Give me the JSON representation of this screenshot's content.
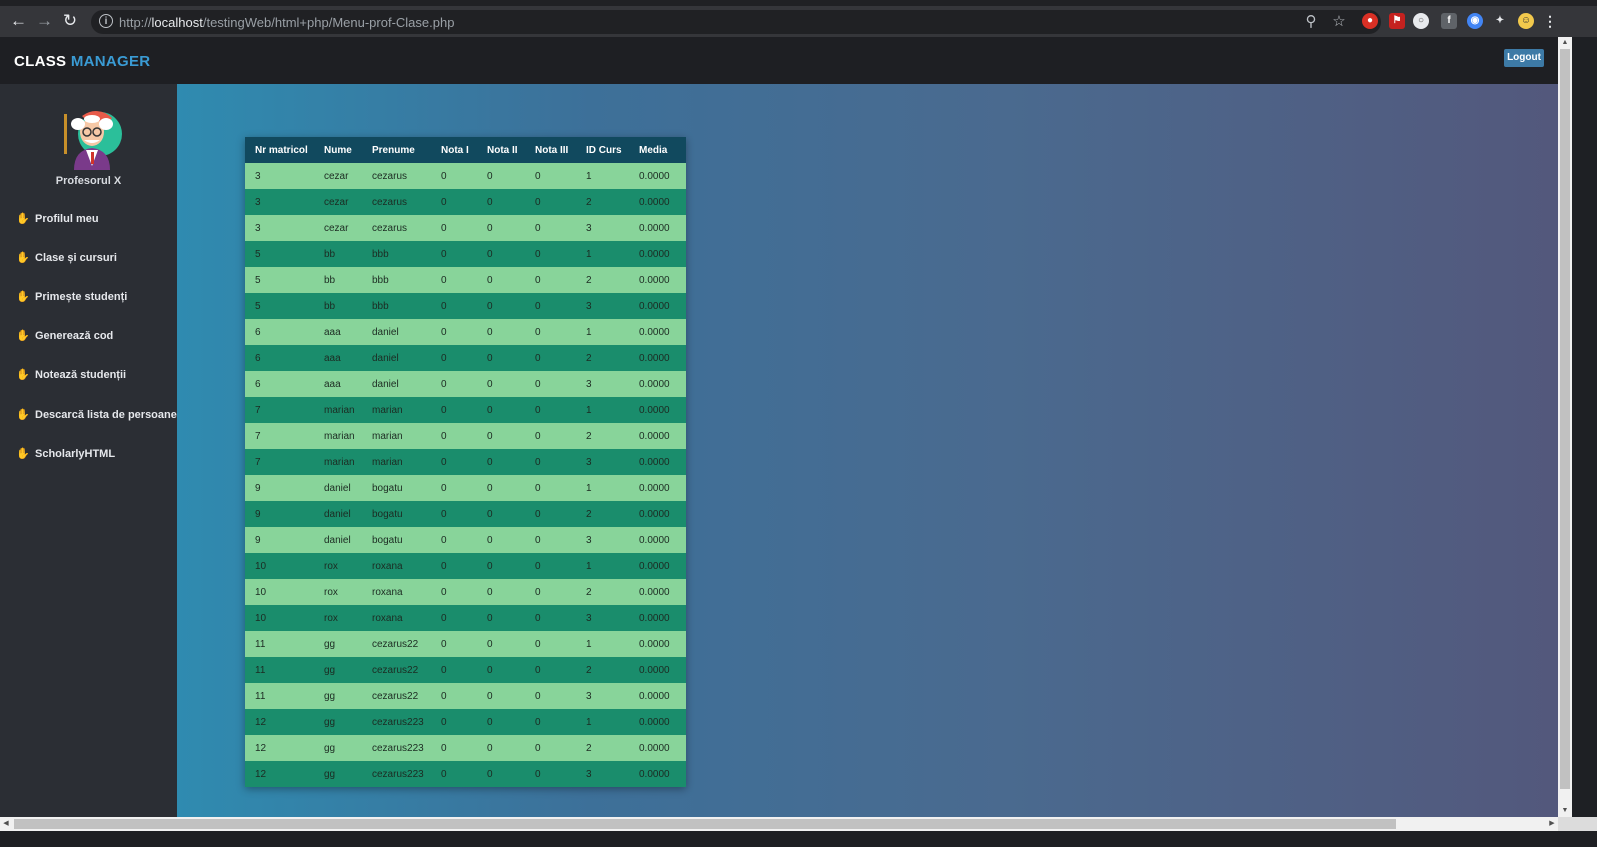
{
  "browser": {
    "url_host": "localhost",
    "url_prefix": "http://",
    "url_path": "/testingWeb/html+php/Menu-prof-Clase.php",
    "icons": [
      "back-icon",
      "forward-icon",
      "reload-icon",
      "info-icon",
      "zoom-icon",
      "star-icon",
      "extensions-icon",
      "menu-icon"
    ]
  },
  "header": {
    "brand_part1": "CLASS",
    "brand_part2": "MANAGER",
    "logout_label": "Logout"
  },
  "colors": {
    "brand_accent": "#3a9bd4",
    "table_header": "#11495e",
    "row_light": "#88d49a",
    "row_dark": "#1a8d6c",
    "sidebar_bg": "#2b2e34"
  },
  "sidebar": {
    "profile_name": "Profesorul X",
    "items": [
      {
        "label": "Profilul meu"
      },
      {
        "label": "Clase și cursuri"
      },
      {
        "label": "Primește studenți"
      },
      {
        "label": "Generează cod"
      },
      {
        "label": "Notează studenții"
      },
      {
        "label": "Descarcă lista de persoane"
      },
      {
        "label": "ScholarlyHTML"
      }
    ]
  },
  "table": {
    "columns": [
      "Nr matricol",
      "Nume",
      "Prenume",
      "Nota I",
      "Nota II",
      "Nota III",
      "ID Curs",
      "Media"
    ],
    "rows": [
      [
        "3",
        "cezar",
        "cezarus",
        "0",
        "0",
        "0",
        "1",
        "0.0000"
      ],
      [
        "3",
        "cezar",
        "cezarus",
        "0",
        "0",
        "0",
        "2",
        "0.0000"
      ],
      [
        "3",
        "cezar",
        "cezarus",
        "0",
        "0",
        "0",
        "3",
        "0.0000"
      ],
      [
        "5",
        "bb",
        "bbb",
        "0",
        "0",
        "0",
        "1",
        "0.0000"
      ],
      [
        "5",
        "bb",
        "bbb",
        "0",
        "0",
        "0",
        "2",
        "0.0000"
      ],
      [
        "5",
        "bb",
        "bbb",
        "0",
        "0",
        "0",
        "3",
        "0.0000"
      ],
      [
        "6",
        "aaa",
        "daniel",
        "0",
        "0",
        "0",
        "1",
        "0.0000"
      ],
      [
        "6",
        "aaa",
        "daniel",
        "0",
        "0",
        "0",
        "2",
        "0.0000"
      ],
      [
        "6",
        "aaa",
        "daniel",
        "0",
        "0",
        "0",
        "3",
        "0.0000"
      ],
      [
        "7",
        "marian",
        "marian",
        "0",
        "0",
        "0",
        "1",
        "0.0000"
      ],
      [
        "7",
        "marian",
        "marian",
        "0",
        "0",
        "0",
        "2",
        "0.0000"
      ],
      [
        "7",
        "marian",
        "marian",
        "0",
        "0",
        "0",
        "3",
        "0.0000"
      ],
      [
        "9",
        "daniel",
        "bogatu",
        "0",
        "0",
        "0",
        "1",
        "0.0000"
      ],
      [
        "9",
        "daniel",
        "bogatu",
        "0",
        "0",
        "0",
        "2",
        "0.0000"
      ],
      [
        "9",
        "daniel",
        "bogatu",
        "0",
        "0",
        "0",
        "3",
        "0.0000"
      ],
      [
        "10",
        "rox",
        "roxana",
        "0",
        "0",
        "0",
        "1",
        "0.0000"
      ],
      [
        "10",
        "rox",
        "roxana",
        "0",
        "0",
        "0",
        "2",
        "0.0000"
      ],
      [
        "10",
        "rox",
        "roxana",
        "0",
        "0",
        "0",
        "3",
        "0.0000"
      ],
      [
        "11",
        "gg",
        "cezarus22",
        "0",
        "0",
        "0",
        "1",
        "0.0000"
      ],
      [
        "11",
        "gg",
        "cezarus22",
        "0",
        "0",
        "0",
        "2",
        "0.0000"
      ],
      [
        "11",
        "gg",
        "cezarus22",
        "0",
        "0",
        "0",
        "3",
        "0.0000"
      ],
      [
        "12",
        "gg",
        "cezarus223",
        "0",
        "0",
        "0",
        "1",
        "0.0000"
      ],
      [
        "12",
        "gg",
        "cezarus223",
        "0",
        "0",
        "0",
        "2",
        "0.0000"
      ],
      [
        "12",
        "gg",
        "cezarus223",
        "0",
        "0",
        "0",
        "3",
        "0.0000"
      ]
    ]
  }
}
